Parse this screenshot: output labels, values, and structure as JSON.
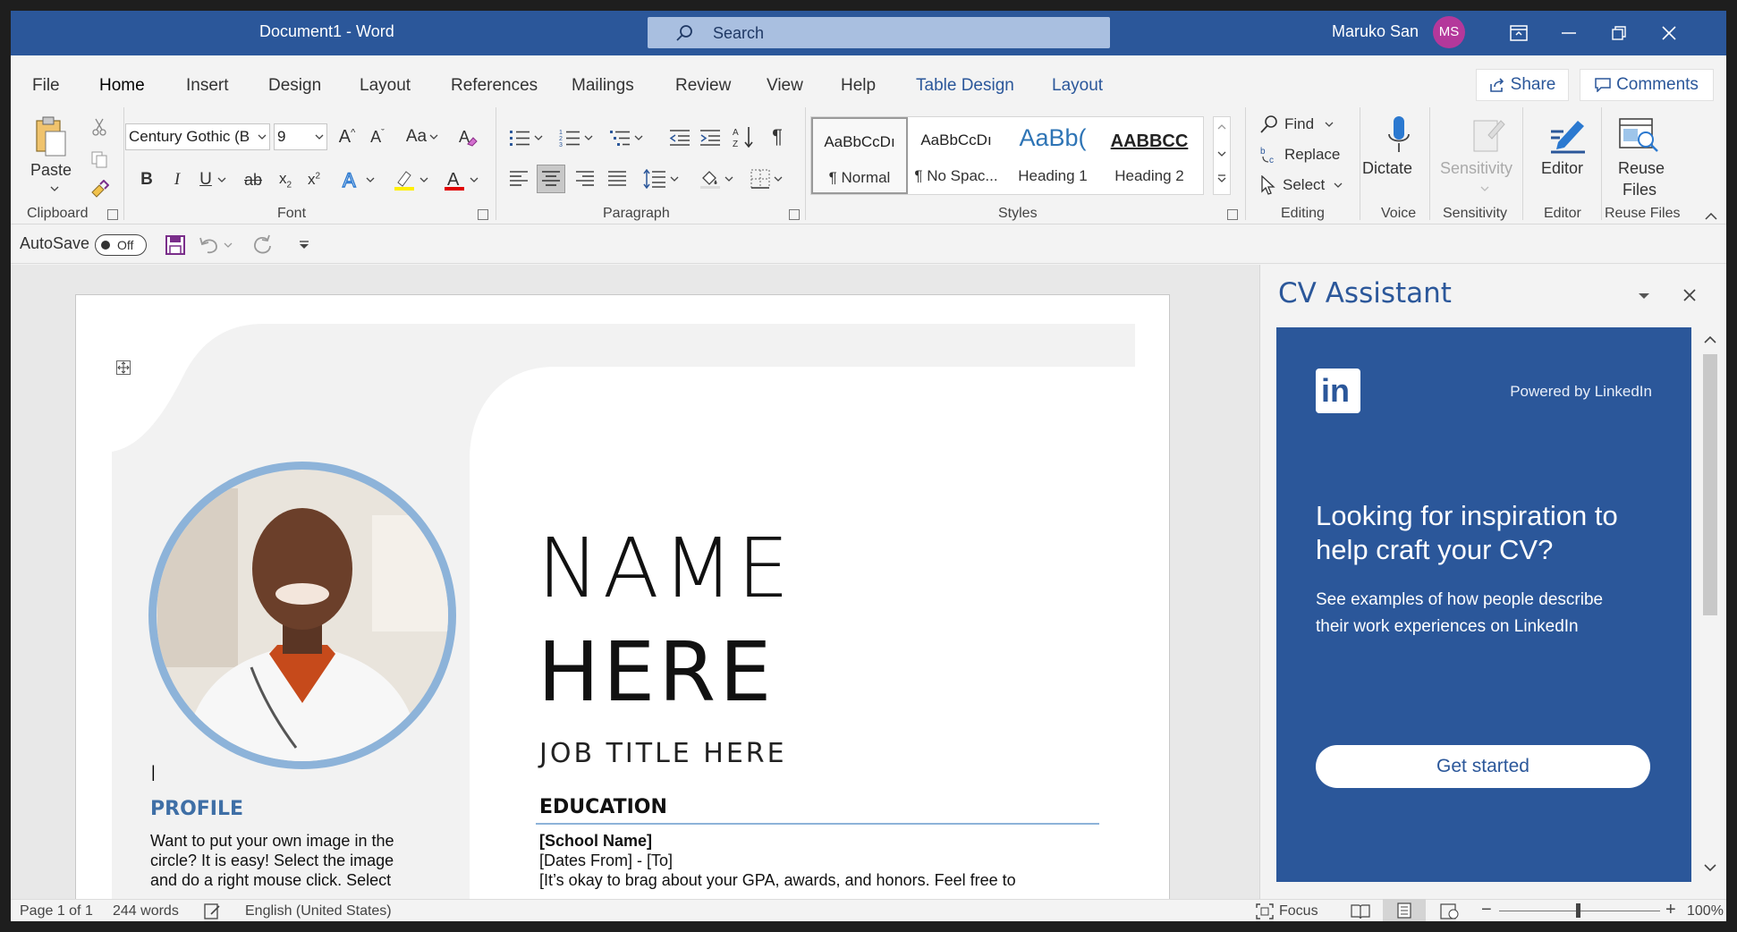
{
  "window": {
    "title": "Document1  -  Word"
  },
  "search": {
    "placeholder": "Search"
  },
  "user": {
    "name": "Maruko San",
    "initials": "MS"
  },
  "tabs": {
    "file": "File",
    "home": "Home",
    "insert": "Insert",
    "design": "Design",
    "layout": "Layout",
    "references": "References",
    "mailings": "Mailings",
    "review": "Review",
    "view": "View",
    "help": "Help",
    "table_design": "Table Design",
    "table_layout": "Layout"
  },
  "actions": {
    "share": "Share",
    "comments": "Comments"
  },
  "ribbon": {
    "clipboard": {
      "paste": "Paste",
      "label": "Clipboard"
    },
    "font": {
      "name": "Century Gothic (B",
      "size": "9",
      "change_case": "Aa",
      "label": "Font"
    },
    "paragraph": {
      "label": "Paragraph"
    },
    "styles": {
      "label": "Styles",
      "items": [
        {
          "preview": "AaBbCcDı",
          "name": "¶ Normal"
        },
        {
          "preview": "AaBbCcDı",
          "name": "¶ No Spac..."
        },
        {
          "preview": "AaBb(",
          "name": "Heading 1"
        },
        {
          "preview": "AABBCC",
          "name": "Heading 2"
        }
      ]
    },
    "editing": {
      "find": "Find",
      "replace": "Replace",
      "select": "Select",
      "label": "Editing"
    },
    "voice": {
      "dictate": "Dictate",
      "label": "Voice"
    },
    "sensitivity": {
      "button": "Sensitivity",
      "label": "Sensitivity"
    },
    "editor": {
      "button": "Editor",
      "label": "Editor"
    },
    "reuse": {
      "button_line1": "Reuse",
      "button_line2": "Files",
      "label": "Reuse Files"
    }
  },
  "qat": {
    "autosave": "AutoSave",
    "toggle": "Off"
  },
  "document": {
    "name_line1": "NAME",
    "name_line2": "HERE",
    "job_title": "JOB TITLE HERE",
    "profile_heading": "PROFILE",
    "profile_lines": [
      "Want to put your own image in the",
      "circle?  It is easy!  Select the image",
      "and do a right mouse click.  Select"
    ],
    "education_heading": "EDUCATION",
    "school": "[School Name]",
    "dates": "[Dates From] - [To]",
    "note": "[It’s okay to brag about your GPA, awards, and honors. Feel free to"
  },
  "pane": {
    "title": "CV Assistant",
    "powered": "Powered by LinkedIn",
    "headline_line1": "Looking for inspiration to",
    "headline_line2": "help craft your CV?",
    "body_line1": "See examples of how people describe",
    "body_line2": "their work experiences on LinkedIn",
    "cta": "Get started"
  },
  "status": {
    "page": "Page 1 of 1",
    "words": "244 words",
    "language": "English (United States)",
    "focus": "Focus",
    "zoom": "100%"
  },
  "colors": {
    "word_blue": "#2b579a",
    "accent_light": "#8db3d9",
    "linkedin_card": "#2b579a"
  }
}
